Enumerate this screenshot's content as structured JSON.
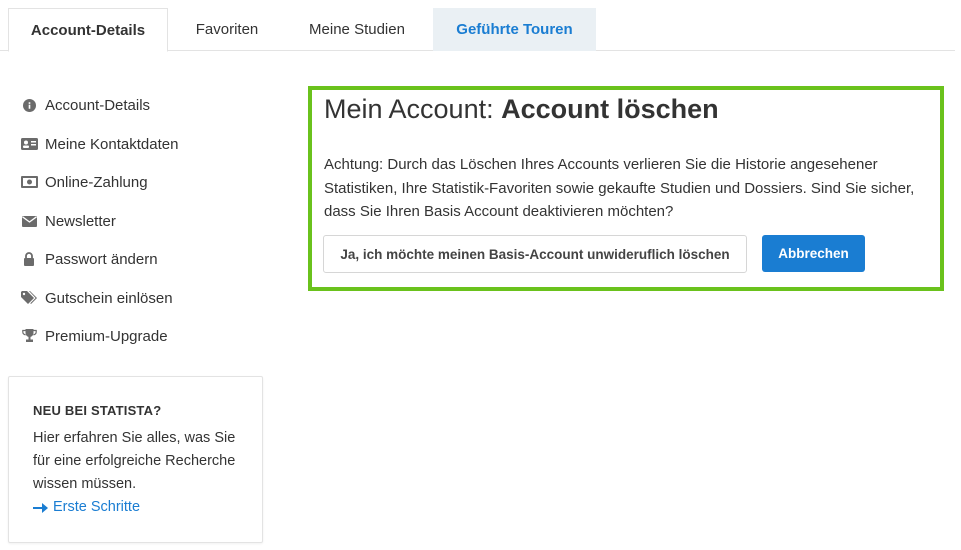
{
  "tabs": {
    "account_details": "Account-Details",
    "favorites": "Favoriten",
    "my_studies": "Meine Studien",
    "guided_tours": "Geführte Touren"
  },
  "sidebar": {
    "items": [
      {
        "label": "Account-Details",
        "icon": "info-circle-icon"
      },
      {
        "label": "Meine Kontaktdaten",
        "icon": "id-card-icon"
      },
      {
        "label": "Online-Zahlung",
        "icon": "money-bill-icon"
      },
      {
        "label": "Newsletter",
        "icon": "envelope-icon"
      },
      {
        "label": "Passwort ändern",
        "icon": "lock-icon"
      },
      {
        "label": "Gutschein einlösen",
        "icon": "tags-icon"
      },
      {
        "label": "Premium-Upgrade",
        "icon": "trophy-icon"
      }
    ]
  },
  "info_box": {
    "title": "NEU BEI STATISTA?",
    "text": "Hier erfahren Sie alles, was Sie für eine erfolgreiche Recherche wissen müssen.",
    "link_label": "Erste Schritte",
    "link_icon": "arrow-right-icon"
  },
  "panel": {
    "title_prefix": "Mein Account: ",
    "title_bold": "Account löschen",
    "warning_text": "Achtung: Durch das Löschen Ihres Accounts verlieren Sie die Historie angesehener Statistiken, Ihre Statistik-Favoriten sowie gekaufte Studien und Dossiers. Sind Sie sicher, dass Sie Ihren Basis Account deaktivieren möchten?",
    "delete_button": "Ja, ich möchte meinen Basis-Account unwideruflich löschen",
    "cancel_button": "Abbrechen"
  },
  "colors": {
    "accent_blue": "#1a7dd2",
    "highlight_green": "#6ac21c",
    "tab_highlight_bg": "#eaf0f4"
  }
}
